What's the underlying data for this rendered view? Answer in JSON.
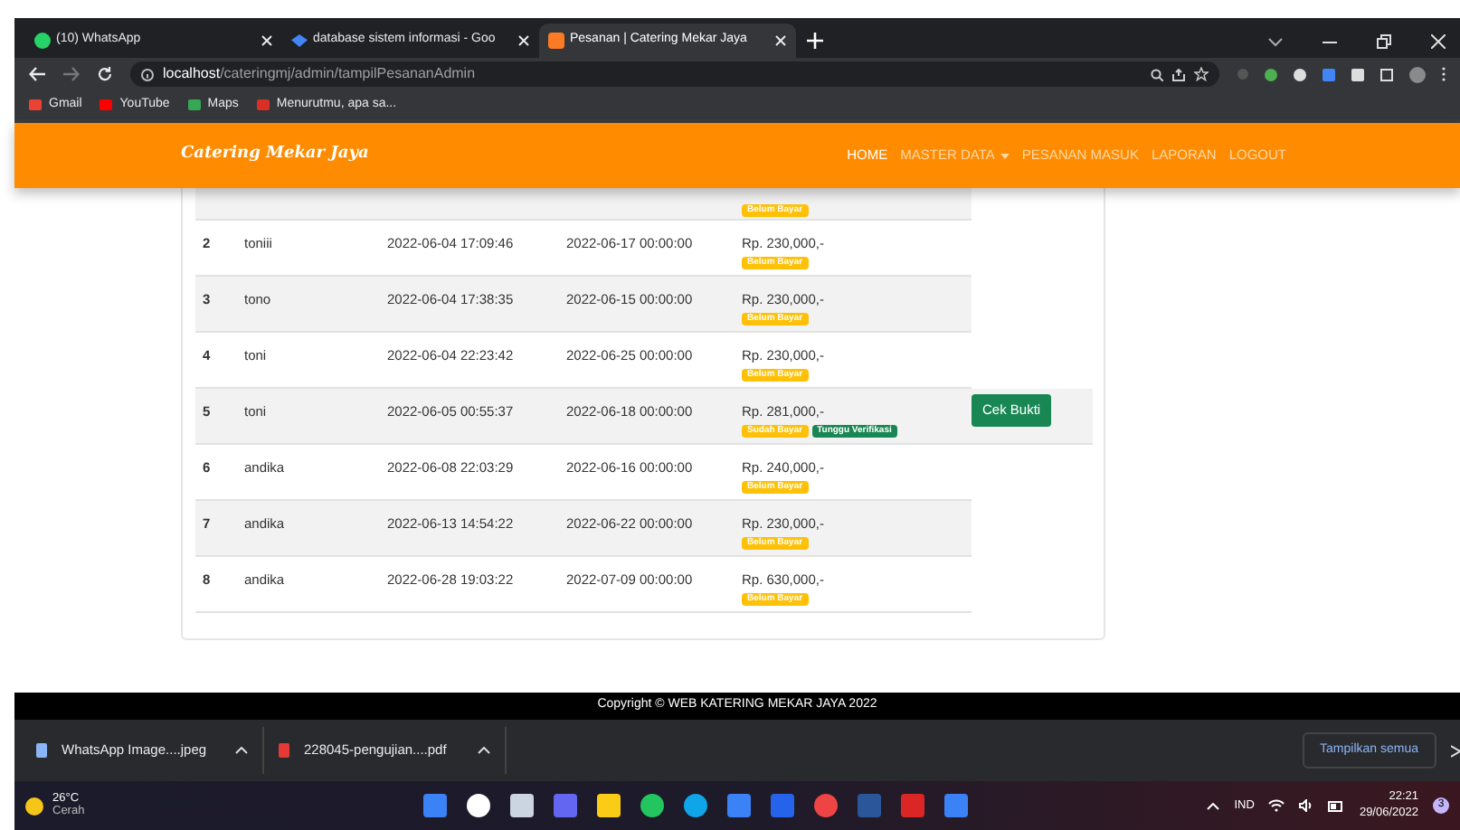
{
  "browser": {
    "tabs": [
      {
        "title": "(10) WhatsApp",
        "kind": "whatsapp",
        "selected": false
      },
      {
        "title": "database sistem informasi - Goo",
        "kind": "scholar",
        "selected": false
      },
      {
        "title": "Pesanan | Catering Mekar Jaya",
        "kind": "xampp",
        "selected": true
      }
    ],
    "address": {
      "host": "localhost",
      "path": "/cateringmj/admin/tampilPesananAdmin"
    },
    "bookmarks": [
      {
        "label": "Gmail",
        "color": "#ea4335"
      },
      {
        "label": "YouTube",
        "color": "#ff0000"
      },
      {
        "label": "Maps",
        "color": "#34a853"
      },
      {
        "label": "Menurutmu, apa sa...",
        "color": "#d93025"
      }
    ]
  },
  "navbar": {
    "brand": "Catering Mekar Jaya",
    "items": [
      {
        "label": "HOME",
        "kind": "link",
        "selected": true
      },
      {
        "label": "MASTER DATA",
        "kind": "dropdown",
        "selected": false
      },
      {
        "label": "PESANAN MASUK",
        "kind": "link",
        "selected": false
      },
      {
        "label": "LAPORAN",
        "kind": "link",
        "selected": false
      },
      {
        "label": "LOGOUT",
        "kind": "link",
        "selected": false
      }
    ]
  },
  "orders": [
    {
      "badges": [
        {
          "label": "Belum Bayar",
          "kind": "warning"
        }
      ]
    },
    {
      "no": "2",
      "name": "toniii",
      "order_date": "2022-06-04 17:09:46",
      "delivery_date": "2022-06-17 00:00:00",
      "price": "Rp. 230,000,-",
      "badges": [
        {
          "label": "Belum Bayar",
          "kind": "warning"
        }
      ]
    },
    {
      "no": "3",
      "name": "tono",
      "order_date": "2022-06-04 17:38:35",
      "delivery_date": "2022-06-15 00:00:00",
      "price": "Rp. 230,000,-",
      "badges": [
        {
          "label": "Belum Bayar",
          "kind": "warning"
        }
      ]
    },
    {
      "no": "4",
      "name": "toni",
      "order_date": "2022-06-04 22:23:42",
      "delivery_date": "2022-06-25 00:00:00",
      "price": "Rp. 230,000,-",
      "badges": [
        {
          "label": "Belum Bayar",
          "kind": "warning"
        }
      ]
    },
    {
      "no": "5",
      "name": "toni",
      "order_date": "2022-06-05 00:55:37",
      "delivery_date": "2022-06-18 00:00:00",
      "price": "Rp. 281,000,-",
      "badges": [
        {
          "label": "Sudah Bayar",
          "kind": "warning"
        },
        {
          "label": "Tunggu Verifikasi",
          "kind": "success"
        }
      ],
      "action": "Cek Bukti"
    },
    {
      "no": "6",
      "name": "andika",
      "order_date": "2022-06-08 22:03:29",
      "delivery_date": "2022-06-16 00:00:00",
      "price": "Rp. 240,000,-",
      "badges": [
        {
          "label": "Belum Bayar",
          "kind": "warning"
        }
      ]
    },
    {
      "no": "7",
      "name": "andika",
      "order_date": "2022-06-13 14:54:22",
      "delivery_date": "2022-06-22 00:00:00",
      "price": "Rp. 230,000,-",
      "badges": [
        {
          "label": "Belum Bayar",
          "kind": "warning"
        }
      ]
    },
    {
      "no": "8",
      "name": "andika",
      "order_date": "2022-06-28 19:03:22",
      "delivery_date": "2022-07-09 00:00:00",
      "price": "Rp. 630,000,-",
      "badges": [
        {
          "label": "Belum Bayar",
          "kind": "warning"
        }
      ]
    }
  ],
  "footer": "Copyright © WEB KATERING MEKAR JAYA 2022",
  "downloads": {
    "items": [
      {
        "name": "WhatsApp Image....jpeg",
        "kind": "image"
      },
      {
        "name": "228045-pengujian....pdf",
        "kind": "pdf"
      }
    ],
    "show_all": "Tampilkan semua"
  },
  "taskbar": {
    "weather": {
      "temp": "26°C",
      "condition": "Cerah"
    },
    "apps": [
      {
        "kind": "start",
        "color": "#3b82f6"
      },
      {
        "kind": "search",
        "color": "#ffffff"
      },
      {
        "kind": "taskview",
        "color": "#cbd5e1"
      },
      {
        "kind": "chat",
        "color": "#6366f1"
      },
      {
        "kind": "folder",
        "color": "#facc15"
      },
      {
        "kind": "chrome",
        "color": "#22c55e"
      },
      {
        "kind": "edge",
        "color": "#0ea5e9"
      },
      {
        "kind": "mail",
        "color": "#3b82f6"
      },
      {
        "kind": "letter",
        "color": "#2563eb"
      },
      {
        "kind": "opera",
        "color": "#ef4444"
      },
      {
        "kind": "word",
        "color": "#2b579a"
      },
      {
        "kind": "archive",
        "color": "#dc2626"
      },
      {
        "kind": "vscode",
        "color": "#3b82f6"
      }
    ],
    "lang": "IND",
    "time": "22:21",
    "date": "29/06/2022",
    "notifications": "3"
  }
}
